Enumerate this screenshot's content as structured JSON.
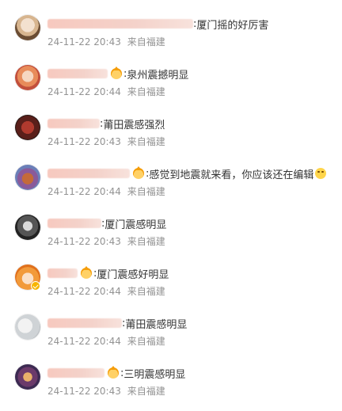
{
  "comments": [
    {
      "text": "厦门摇的好厉害",
      "timestamp": "24-11-22 20:43",
      "source": "来自福建",
      "avatar_icon": "avatar-girl-photo"
    },
    {
      "text": "泉州震撼明显",
      "timestamp": "24-11-22 20:44",
      "source": "来自福建",
      "avatar_icon": "avatar-anime-girl"
    },
    {
      "text": "莆田震感强烈",
      "timestamp": "24-11-22 20:43",
      "source": "来自福建",
      "avatar_icon": "avatar-red-photo"
    },
    {
      "text": "感觉到地震就来看，你应该还在编辑",
      "timestamp": "24-11-22 20:44",
      "source": "来自福建",
      "avatar_icon": "avatar-character"
    },
    {
      "text": "厦门震感明显",
      "timestamp": "24-11-22 20:43",
      "source": "来自福建",
      "avatar_icon": "avatar-dark-anime"
    },
    {
      "text": "厦门震感好明显",
      "timestamp": "24-11-22 20:44",
      "source": "来自福建",
      "avatar_icon": "avatar-orange-anime"
    },
    {
      "text": "莆田震感明显",
      "timestamp": "24-11-22 20:44",
      "source": "来自福建",
      "avatar_icon": "avatar-gray"
    },
    {
      "text": "三明震感明显",
      "timestamp": "24-11-22 20:43",
      "source": "来自福建",
      "avatar_icon": "avatar-game-photo"
    }
  ],
  "colors": {
    "text": "#333333",
    "meta": "#939393",
    "verified": "#f7b500"
  }
}
